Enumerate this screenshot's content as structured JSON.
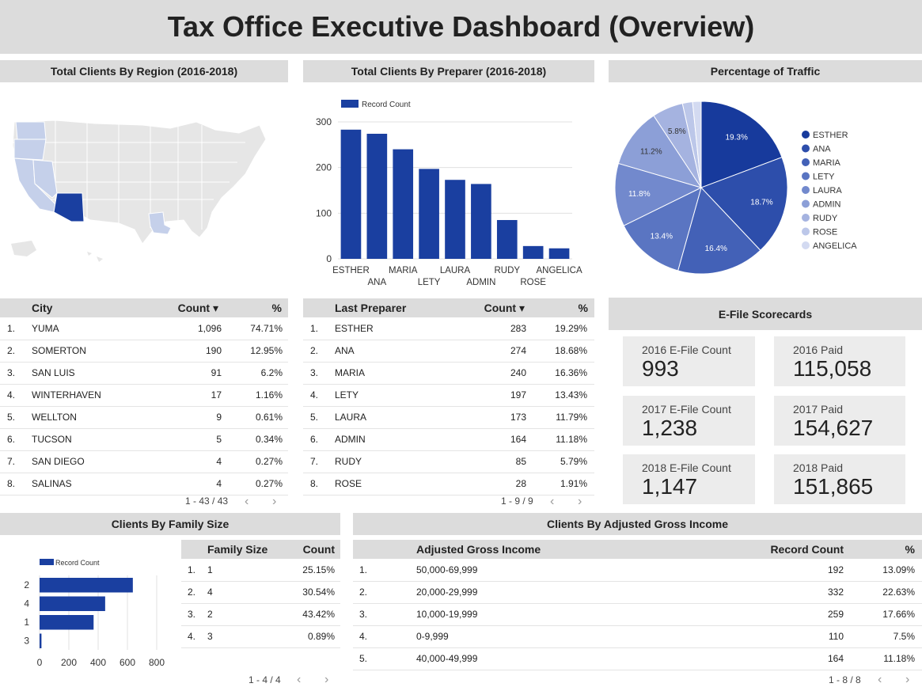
{
  "title": "Tax Office Executive Dashboard (Overview)",
  "panels": {
    "region": "Total Clients By Region (2016-2018)",
    "preparer": "Total Clients By Preparer (2016-2018)",
    "traffic": "Percentage of Traffic",
    "scorecards": "E-File Scorecards",
    "family": "Clients By Family Size",
    "agi": "Clients By Adjusted Gross Income"
  },
  "city_table": {
    "headers": [
      "City",
      "Count ▾",
      "%"
    ],
    "rows": [
      [
        "1.",
        "YUMA",
        "1,096",
        "74.71%"
      ],
      [
        "2.",
        "SOMERTON",
        "190",
        "12.95%"
      ],
      [
        "3.",
        "SAN LUIS",
        "91",
        "6.2%"
      ],
      [
        "4.",
        "WINTERHAVEN",
        "17",
        "1.16%"
      ],
      [
        "5.",
        "WELLTON",
        "9",
        "0.61%"
      ],
      [
        "6.",
        "TUCSON",
        "5",
        "0.34%"
      ],
      [
        "7.",
        "SAN DIEGO",
        "4",
        "0.27%"
      ],
      [
        "8.",
        "SALINAS",
        "4",
        "0.27%"
      ]
    ],
    "pager": "1 - 43 / 43"
  },
  "preparer_table": {
    "headers": [
      "Last Preparer",
      "Count ▾",
      "%"
    ],
    "rows": [
      [
        "1.",
        "ESTHER",
        "283",
        "19.29%"
      ],
      [
        "2.",
        "ANA",
        "274",
        "18.68%"
      ],
      [
        "3.",
        "MARIA",
        "240",
        "16.36%"
      ],
      [
        "4.",
        "LETY",
        "197",
        "13.43%"
      ],
      [
        "5.",
        "LAURA",
        "173",
        "11.79%"
      ],
      [
        "6.",
        "ADMIN",
        "164",
        "11.18%"
      ],
      [
        "7.",
        "RUDY",
        "85",
        "5.79%"
      ],
      [
        "8.",
        "ROSE",
        "28",
        "1.91%"
      ]
    ],
    "pager": "1 - 9 / 9"
  },
  "scorecards": [
    {
      "label": "2016 E-File Count",
      "value": "993"
    },
    {
      "label": "2016 Paid",
      "value": "115,058"
    },
    {
      "label": "2017 E-File Count",
      "value": "1,238"
    },
    {
      "label": "2017 Paid",
      "value": "154,627"
    },
    {
      "label": "2018 E-File Count",
      "value": "1,147"
    },
    {
      "label": "2018 Paid",
      "value": "151,865"
    }
  ],
  "family_table": {
    "headers": [
      "Family Size",
      "Count"
    ],
    "rows": [
      [
        "1.",
        "1",
        "25.15%"
      ],
      [
        "2.",
        "4",
        "30.54%"
      ],
      [
        "3.",
        "2",
        "43.42%"
      ],
      [
        "4.",
        "3",
        "0.89%"
      ]
    ],
    "pager": "1 - 4 / 4"
  },
  "agi_table": {
    "headers": [
      "Adjusted Gross Income",
      "Record Count",
      "%"
    ],
    "rows": [
      [
        "1.",
        "50,000-69,999",
        "192",
        "13.09%"
      ],
      [
        "2.",
        "20,000-29,999",
        "332",
        "22.63%"
      ],
      [
        "3.",
        "10,000-19,999",
        "259",
        "17.66%"
      ],
      [
        "4.",
        "0-9,999",
        "110",
        "7.5%"
      ],
      [
        "5.",
        "40,000-49,999",
        "164",
        "11.18%"
      ]
    ],
    "pager": "1 - 8 / 8"
  },
  "map": {
    "highlighted_states": [
      "AZ",
      "CA",
      "NV",
      "OR",
      "WA",
      "LA"
    ],
    "colors": {
      "strong": "#1a3fa0",
      "light": "#c5d0ea",
      "base": "#e6e6e6"
    }
  },
  "chart_data": [
    {
      "type": "bar",
      "legend": "Record Count",
      "categories": [
        "ESTHER",
        "ANA",
        "MARIA",
        "LETY",
        "LAURA",
        "ADMIN",
        "RUDY",
        "ROSE",
        "ANGELICA"
      ],
      "values": [
        283,
        274,
        240,
        197,
        173,
        164,
        85,
        28,
        23
      ],
      "yticks": [
        0,
        100,
        200,
        300
      ],
      "ylim": [
        0,
        300
      ],
      "color": "#1a3fa0"
    },
    {
      "type": "pie",
      "labels": [
        "ESTHER",
        "ANA",
        "MARIA",
        "LETY",
        "LAURA",
        "ADMIN",
        "RUDY",
        "ROSE",
        "ANGELICA"
      ],
      "values": [
        19.3,
        18.7,
        16.4,
        13.4,
        11.8,
        11.2,
        5.8,
        1.9,
        1.6
      ],
      "value_labels": [
        "19.3%",
        "18.7%",
        "16.4%",
        "13.4%",
        "11.8%",
        "11.2%",
        "5.8%",
        "",
        ""
      ],
      "colors": [
        "#173a9c",
        "#2d4eab",
        "#4361b7",
        "#5a75c2",
        "#7289cd",
        "#8c9fd7",
        "#a5b3e0",
        "#bcc7e9",
        "#d3daf1"
      ]
    },
    {
      "type": "bar",
      "orientation": "horizontal",
      "legend": "Record Count",
      "categories": [
        "2",
        "4",
        "1",
        "3"
      ],
      "values": [
        637,
        448,
        369,
        13
      ],
      "xticks": [
        0,
        200,
        400,
        600,
        800
      ],
      "xlim": [
        0,
        800
      ],
      "color": "#1a3fa0"
    }
  ]
}
